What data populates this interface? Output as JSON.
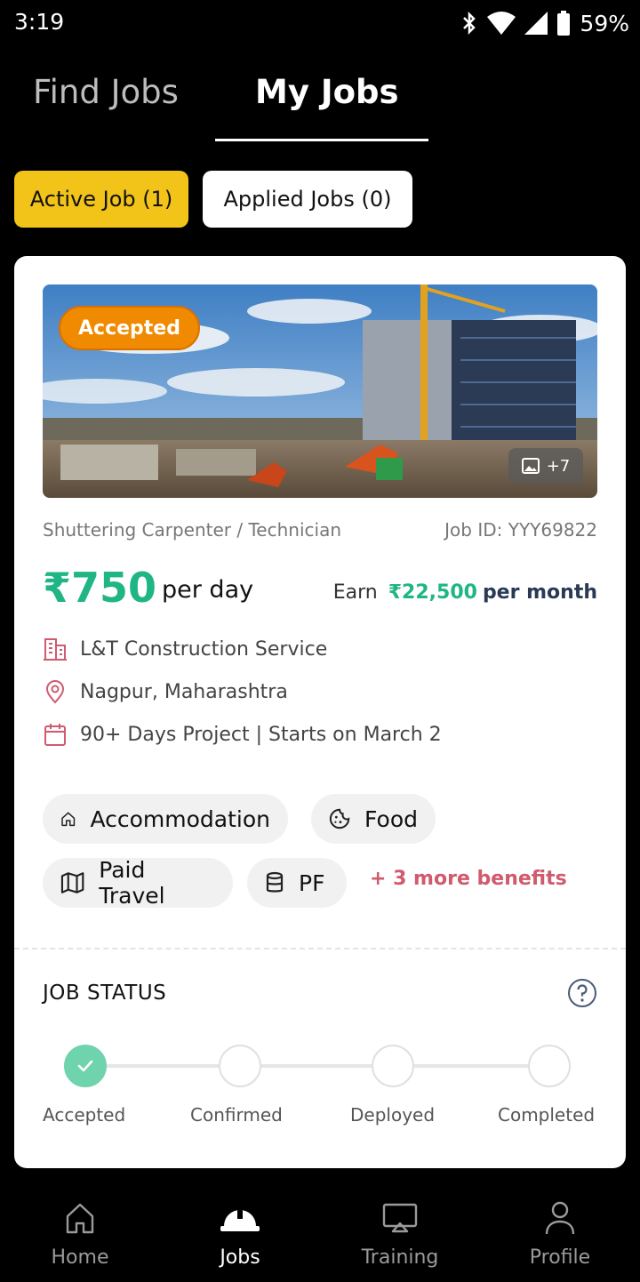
{
  "status_bar": {
    "time": "3:19",
    "battery": "59%"
  },
  "top_tabs": {
    "find_jobs": "Find Jobs",
    "my_jobs": "My Jobs"
  },
  "filters": {
    "active": "Active Job (1)",
    "applied": "Applied Jobs (0)"
  },
  "job": {
    "status_badge": "Accepted",
    "photo_count": "+7",
    "title": "Shuttering Carpenter / Technician",
    "job_id": "Job ID: YYY69822",
    "pay_amount": "₹750",
    "pay_unit": "per day",
    "earn_label": "Earn",
    "earn_amount": "₹22,500",
    "earn_period": "per month",
    "company": "L&T Construction Service",
    "location": "Nagpur, Maharashtra",
    "duration": "90+ Days Project | Starts on March 2",
    "benefits": [
      {
        "label": "Accommodation",
        "icon": "home-icon"
      },
      {
        "label": "Food",
        "icon": "food-icon"
      },
      {
        "label": "Paid Travel",
        "icon": "map-icon"
      },
      {
        "label": "PF",
        "icon": "database-icon"
      }
    ],
    "more_benefits": "+ 3 more benefits"
  },
  "job_status": {
    "title": "JOB STATUS",
    "steps": [
      {
        "label": "Accepted",
        "done": true
      },
      {
        "label": "Confirmed",
        "done": false
      },
      {
        "label": "Deployed",
        "done": false
      },
      {
        "label": "Completed",
        "done": false
      }
    ]
  },
  "bottom_nav": {
    "items": [
      {
        "label": "Home",
        "icon": "home-icon"
      },
      {
        "label": "Jobs",
        "icon": "hard-hat-icon",
        "active": true
      },
      {
        "label": "Training",
        "icon": "screen-icon"
      },
      {
        "label": "Profile",
        "icon": "person-icon"
      }
    ]
  },
  "colors": {
    "accent_yellow": "#f2c318",
    "accent_green": "#1fb584",
    "badge_orange": "#f08a00",
    "link_pink": "#d05a6e"
  }
}
